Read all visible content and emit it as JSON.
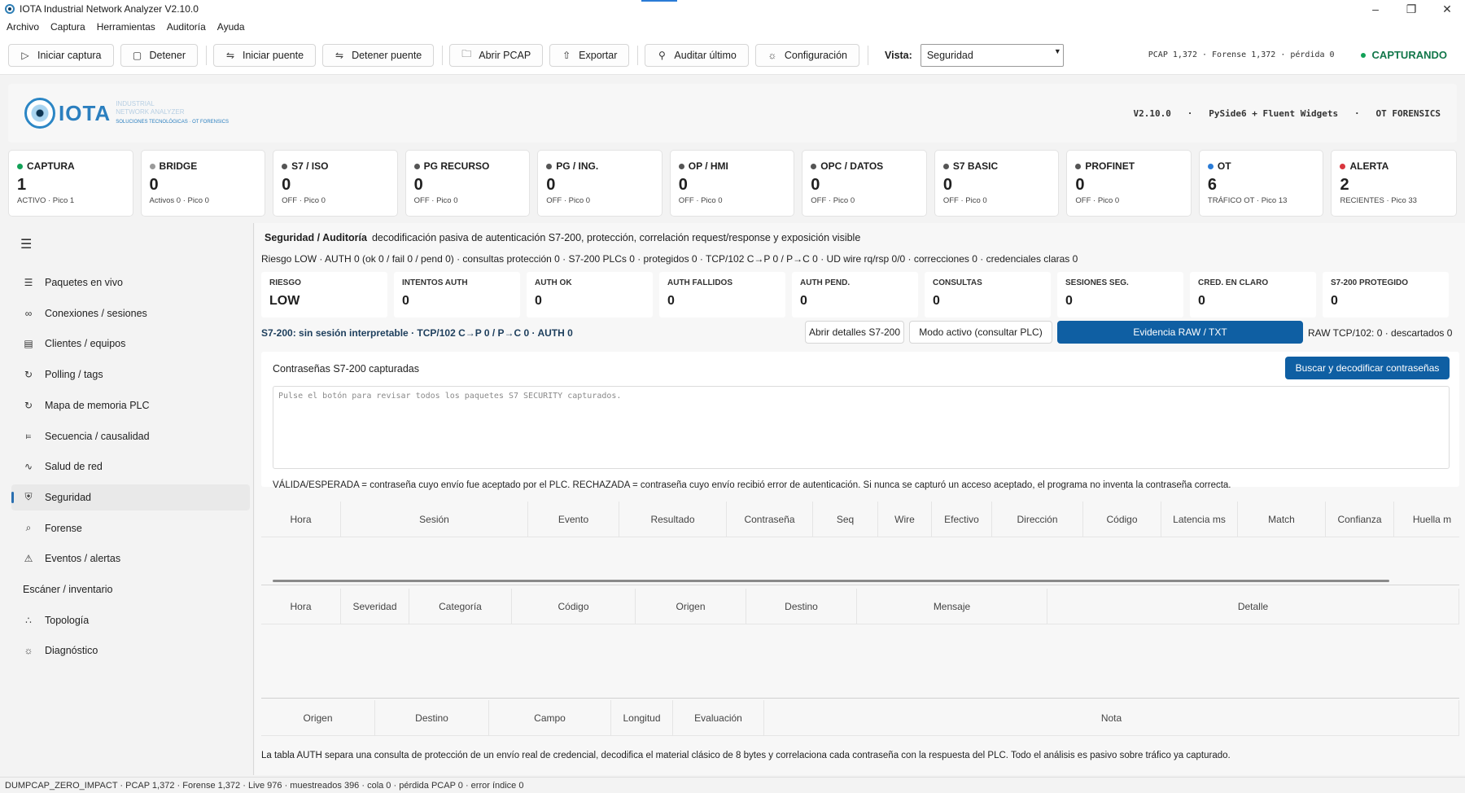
{
  "window": {
    "title": "IOTA Industrial Network Analyzer V2.10.0"
  },
  "menu": [
    "Archivo",
    "Captura",
    "Herramientas",
    "Auditoría",
    "Ayuda"
  ],
  "toolbar": {
    "iniciar_captura": "Iniciar captura",
    "detener": "Detener",
    "iniciar_puente": "Iniciar puente",
    "detener_puente": "Detener puente",
    "abrir_pcap": "Abrir PCAP",
    "exportar": "Exportar",
    "auditar": "Auditar último",
    "configuracion": "Configuración",
    "vista_label": "Vista:",
    "vista_value": "Seguridad",
    "counters": "PCAP 1,372 · Forense 1,372 · pérdida 0",
    "status": "CAPTURANDO",
    "status_color": "#12774a"
  },
  "brand": {
    "logo_text": "IOTA",
    "logo_line1": "INDUSTRIAL",
    "logo_line2": "NETWORK ANALYZER",
    "logo_tagline": "SOLUCIONES TECNOLÓGICAS  ·  OT FORENSICS",
    "right": "V2.10.0   ·   PySide6 + Fluent Widgets   ·   OT FORENSICS"
  },
  "cards": [
    {
      "title": "CAPTURA",
      "value": "1",
      "sub": "ACTIVO  ·  Pico 1",
      "dot": "#12a157"
    },
    {
      "title": "BRIDGE",
      "value": "0",
      "sub": "Activos 0  ·  Pico 0",
      "dot": "#9a9a9a"
    },
    {
      "title": "S7 / ISO",
      "value": "0",
      "sub": "OFF  ·  Pico 0",
      "dot": "#555555"
    },
    {
      "title": "PG RECURSO",
      "value": "0",
      "sub": "OFF  ·  Pico 0",
      "dot": "#555555"
    },
    {
      "title": "PG / ING.",
      "value": "0",
      "sub": "OFF  ·  Pico 0",
      "dot": "#555555"
    },
    {
      "title": "OP / HMI",
      "value": "0",
      "sub": "OFF  ·  Pico 0",
      "dot": "#555555"
    },
    {
      "title": "OPC / DATOS",
      "value": "0",
      "sub": "OFF  ·  Pico 0",
      "dot": "#555555"
    },
    {
      "title": "S7 BASIC",
      "value": "0",
      "sub": "OFF  ·  Pico 0",
      "dot": "#555555"
    },
    {
      "title": "PROFINET",
      "value": "0",
      "sub": "OFF  ·  Pico 0",
      "dot": "#555555"
    },
    {
      "title": "OT",
      "value": "6",
      "sub": "TRÁFICO OT  ·  Pico 13",
      "dot": "#2a7bd6"
    },
    {
      "title": "ALERTA",
      "value": "2",
      "sub": "RECIENTES  ·  Pico 33",
      "dot": "#d9363e"
    }
  ],
  "nav": [
    {
      "label": "Paquetes en vivo",
      "icon": "list-icon"
    },
    {
      "label": "Conexiones / sesiones",
      "icon": "infinity-icon"
    },
    {
      "label": "Clientes / equipos",
      "icon": "device-icon"
    },
    {
      "label": "Polling / tags",
      "icon": "refresh-icon"
    },
    {
      "label": "Mapa de memoria PLC",
      "icon": "refresh-icon"
    },
    {
      "label": "Secuencia / causalidad",
      "icon": "sequence-icon"
    },
    {
      "label": "Salud de red",
      "icon": "pulse-icon"
    },
    {
      "label": "Seguridad",
      "icon": "shield-icon"
    },
    {
      "label": "Forense",
      "icon": "magnifier-icon"
    },
    {
      "label": "Eventos / alertas",
      "icon": "warning-icon"
    },
    {
      "label": "Escáner / inventario",
      "icon": ""
    },
    {
      "label": "Topología",
      "icon": "topology-icon"
    },
    {
      "label": "Diagnóstico",
      "icon": "gear-icon"
    }
  ],
  "security": {
    "title_bold": "Seguridad / Auditoría",
    "title_rest": "decodificación pasiva de autenticación S7-200, protección, correlación request/response y exposición visible",
    "risk_line": "Riesgo LOW · AUTH 0 (ok 0 / fail 0 / pend 0) · consultas protección 0 · S7-200 PLCs 0 · protegidos 0 · TCP/102 C→P 0 / P→C 0 · UD wire rq/rsp 0/0 · correcciones 0 · credenciales claras 0",
    "metrics": [
      {
        "label": "RIESGO",
        "value": "LOW"
      },
      {
        "label": "INTENTOS AUTH",
        "value": "0"
      },
      {
        "label": "AUTH OK",
        "value": "0"
      },
      {
        "label": "AUTH FALLIDOS",
        "value": "0"
      },
      {
        "label": "AUTH PEND.",
        "value": "0"
      },
      {
        "label": "CONSULTAS",
        "value": "0"
      },
      {
        "label": "SESIONES SEG.",
        "value": "0"
      },
      {
        "label": "CRED. EN CLARO",
        "value": "0"
      },
      {
        "label": "S7-200 PROTEGIDO",
        "value": "0"
      }
    ],
    "s7_line": "S7-200: sin sesión interpretable · TCP/102 C→P 0 / P→C 0 · AUTH 0",
    "btn_details": "Abrir detalles S7-200",
    "btn_active": "Modo activo (consultar PLC)",
    "btn_evidence": "Evidencia RAW / TXT",
    "raw_line": "RAW TCP/102: 0 · descartados 0",
    "pwd_title": "Contraseñas S7-200 capturadas",
    "pwd_button": "Buscar y decodificar contraseñas",
    "pwd_placeholder": "Pulse el botón para revisar todos los paquetes S7 SECURITY capturados.",
    "legend": "VÁLIDA/ESPERADA = contraseña cuyo envío fue aceptado por el PLC. RECHAZADA = contraseña cuyo envío recibió error de autenticación. Si nunca se capturó un acceso aceptado, el programa no inventa la contraseña correcta.",
    "auth_columns": [
      "Hora",
      "Sesión",
      "Evento",
      "Resultado",
      "Contraseña",
      "Seq",
      "Wire",
      "Efectivo",
      "Dirección",
      "Código",
      "Latencia ms",
      "Match",
      "Confianza",
      "Huella m"
    ],
    "alert_columns": [
      "Hora",
      "Severidad",
      "Categoría",
      "Código",
      "Origen",
      "Destino",
      "Mensaje",
      "Detalle"
    ],
    "exposure_columns": [
      "Origen",
      "Destino",
      "Campo",
      "Longitud",
      "Evaluación",
      "Nota"
    ],
    "footnote": "La tabla AUTH separa una consulta de protección de un envío real de credencial, decodifica el material clásico de 8 bytes y correlaciona cada contraseña con la respuesta del PLC. Todo el análisis es pasivo sobre tráfico ya capturado."
  },
  "statusbar": "DUMPCAP_ZERO_IMPACT · PCAP 1,372 · Forense 1,372 · Live 976 · muestreados 396 · cola 0 · pérdida PCAP 0 · error índice 0"
}
